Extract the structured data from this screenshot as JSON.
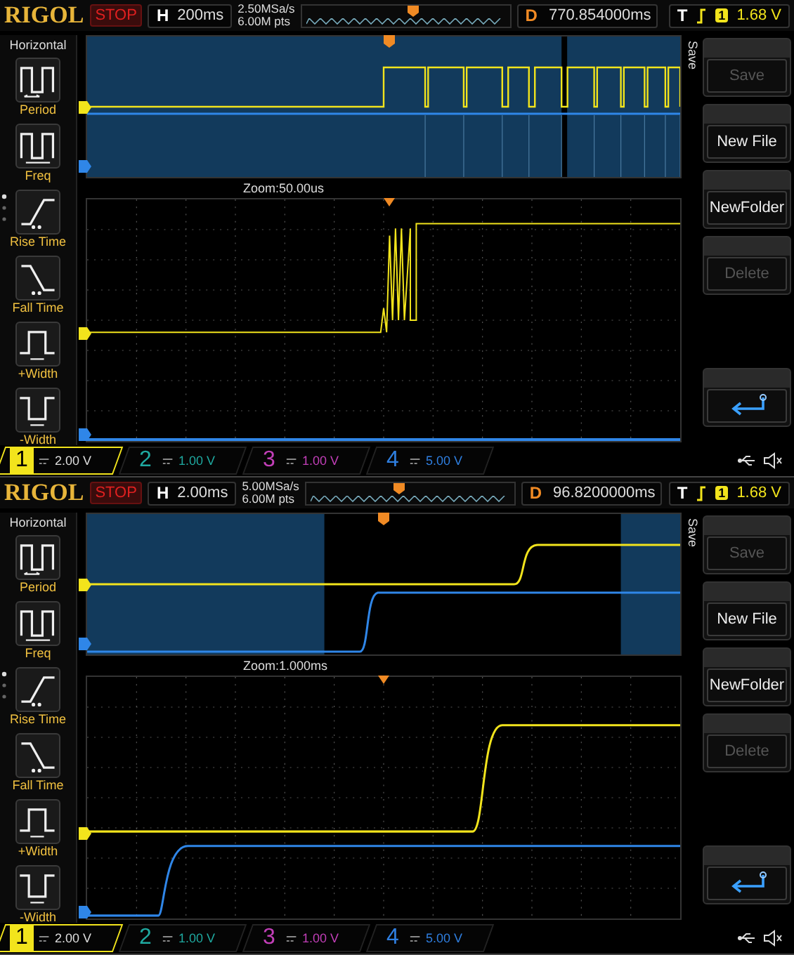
{
  "screens": [
    {
      "brand": "RIGOL",
      "run_state": "STOP",
      "timebase_label": "H",
      "timebase": "200ms",
      "sample_rate": "2.50MSa/s",
      "memory_depth": "6.00M pts",
      "delay_label": "D",
      "delay": "770.854000ms",
      "trigger_label": "T",
      "trigger_source": "1",
      "trigger_level": "1.68 V",
      "kind": "pulse-train",
      "zoom_label": "Zoom:50.00us",
      "sidebar": {
        "title": "Horizontal",
        "items": [
          {
            "kind": "period",
            "label": "Period"
          },
          {
            "kind": "freq",
            "label": "Freq"
          },
          {
            "kind": "rise",
            "label": "Rise Time"
          },
          {
            "kind": "fall",
            "label": "Fall Time"
          },
          {
            "kind": "pwidth",
            "label": "+Width"
          },
          {
            "kind": "nwidth",
            "label": "-Width"
          }
        ]
      },
      "menu": {
        "title": "Save",
        "items": [
          {
            "kind": "text",
            "label": "Save",
            "disabled": true
          },
          {
            "kind": "text",
            "label": "New File",
            "disabled": false
          },
          {
            "kind": "text",
            "label": "NewFolder",
            "disabled": false
          },
          {
            "kind": "text",
            "label": "Delete",
            "disabled": true
          },
          {
            "kind": "blank"
          },
          {
            "kind": "back"
          }
        ]
      },
      "channels": [
        {
          "number": "1",
          "scale": "2.00 V",
          "color": "#f2e41c",
          "selected": true
        },
        {
          "number": "2",
          "scale": "1.00 V",
          "color": "#1fa9a0",
          "selected": false
        },
        {
          "number": "3",
          "scale": "1.00 V",
          "color": "#c23fb8",
          "selected": false
        },
        {
          "number": "4",
          "scale": "5.00 V",
          "color": "#2f7fe0",
          "selected": false
        }
      ]
    },
    {
      "brand": "RIGOL",
      "run_state": "STOP",
      "timebase_label": "H",
      "timebase": "2.00ms",
      "sample_rate": "5.00MSa/s",
      "memory_depth": "6.00M pts",
      "delay_label": "D",
      "delay": "96.8200000ms",
      "trigger_label": "T",
      "trigger_source": "1",
      "trigger_level": "1.68 V",
      "kind": "edge",
      "zoom_label": "Zoom:1.000ms",
      "sidebar": {
        "title": "Horizontal",
        "items": [
          {
            "kind": "period",
            "label": "Period"
          },
          {
            "kind": "freq",
            "label": "Freq"
          },
          {
            "kind": "rise",
            "label": "Rise Time"
          },
          {
            "kind": "fall",
            "label": "Fall Time"
          },
          {
            "kind": "pwidth",
            "label": "+Width"
          },
          {
            "kind": "nwidth",
            "label": "-Width"
          }
        ]
      },
      "menu": {
        "title": "Save",
        "items": [
          {
            "kind": "text",
            "label": "Save",
            "disabled": true
          },
          {
            "kind": "text",
            "label": "New File",
            "disabled": false
          },
          {
            "kind": "text",
            "label": "NewFolder",
            "disabled": false
          },
          {
            "kind": "text",
            "label": "Delete",
            "disabled": true
          },
          {
            "kind": "blank"
          },
          {
            "kind": "back"
          }
        ]
      },
      "channels": [
        {
          "number": "1",
          "scale": "2.00 V",
          "color": "#f2e41c",
          "selected": true
        },
        {
          "number": "2",
          "scale": "1.00 V",
          "color": "#1fa9a0",
          "selected": false
        },
        {
          "number": "3",
          "scale": "1.00 V",
          "color": "#c23fb8",
          "selected": false
        },
        {
          "number": "4",
          "scale": "5.00 V",
          "color": "#2f7fe0",
          "selected": false
        }
      ]
    }
  ]
}
